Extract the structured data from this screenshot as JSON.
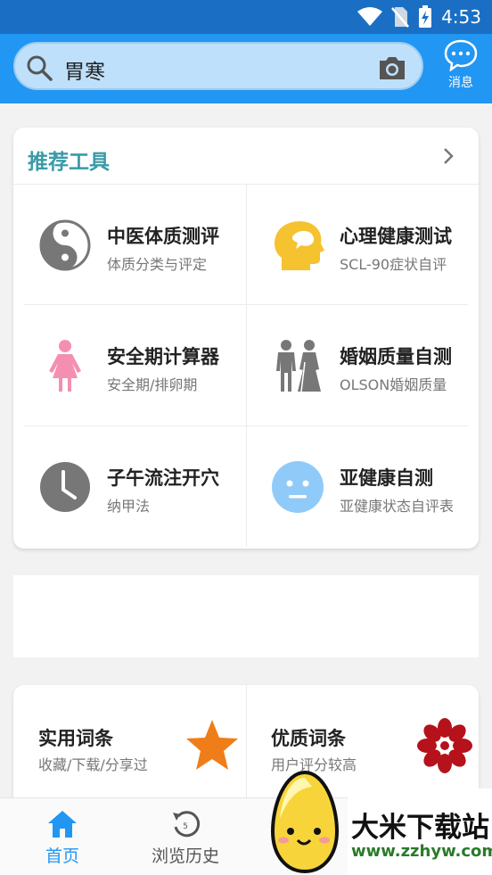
{
  "status": {
    "time": "4:53"
  },
  "search": {
    "query": "胃寒"
  },
  "header": {
    "message_label": "消息"
  },
  "tools": {
    "title": "推荐工具",
    "items": [
      {
        "name": "中医体质测评",
        "sub": "体质分类与评定",
        "icon": "yin-yang-icon"
      },
      {
        "name": "心理健康测试",
        "sub": "SCL-90症状自评",
        "icon": "head-profile-icon"
      },
      {
        "name": "安全期计算器",
        "sub": "安全期/排卵期",
        "icon": "woman-icon"
      },
      {
        "name": "婚姻质量自测",
        "sub": "OLSON婚姻质量",
        "icon": "couple-icon"
      },
      {
        "name": "子午流注开穴",
        "sub": "纳甲法",
        "icon": "clock-icon"
      },
      {
        "name": "亚健康自测",
        "sub": "亚健康状态自评表",
        "icon": "neutral-face-icon"
      }
    ]
  },
  "words": {
    "items": [
      {
        "name": "实用词条",
        "sub": "收藏/下载/分享过",
        "icon": "star-icon"
      },
      {
        "name": "优质词条",
        "sub": "用户评分较高",
        "icon": "flower-icon"
      }
    ]
  },
  "nav": {
    "items": [
      {
        "label": "首页",
        "icon": "home-icon",
        "active": true
      },
      {
        "label": "浏览历史",
        "icon": "history-icon",
        "active": false
      }
    ]
  },
  "watermark": {
    "title": "大米下载站",
    "url": "www.zzhyw.com"
  },
  "colors": {
    "header": "#2196f3",
    "statusbar": "#1a6fc4",
    "accent": "#3a9aa8",
    "nav_active": "#2196f3",
    "star": "#ef7d1a",
    "flower": "#b5121b"
  }
}
